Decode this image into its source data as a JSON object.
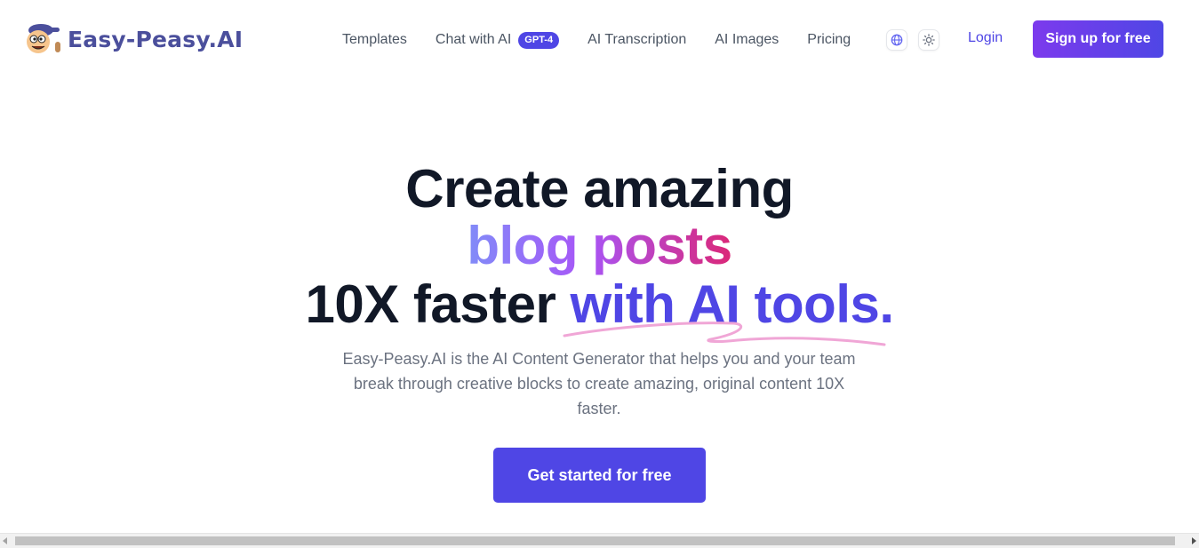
{
  "brand": {
    "name": "Easy-Peasy.AI",
    "color": "#4b4f9c"
  },
  "nav": {
    "templates": "Templates",
    "chat": "Chat with AI",
    "chat_badge": "GPT-4",
    "transcription": "AI Transcription",
    "images": "AI Images",
    "pricing": "Pricing"
  },
  "icons": {
    "language": "globe-icon",
    "theme": "sun-icon"
  },
  "auth": {
    "login": "Login",
    "signup": "Sign up for free"
  },
  "hero": {
    "line1": "Create amazing",
    "line2": "blog posts",
    "line3_plain": "10X faster ",
    "line3_accent": "with AI tools.",
    "subtitle": "Easy-Peasy.AI is the AI Content Generator that helps you and your team break through creative blocks to create amazing, original content 10X faster.",
    "cta": "Get started for free"
  },
  "colors": {
    "accent": "#4f46e5",
    "signup_gradient_start": "#7c3aed",
    "headline": "#111827",
    "subtitle": "#6b7280",
    "squiggle": "#f0a6d6"
  }
}
